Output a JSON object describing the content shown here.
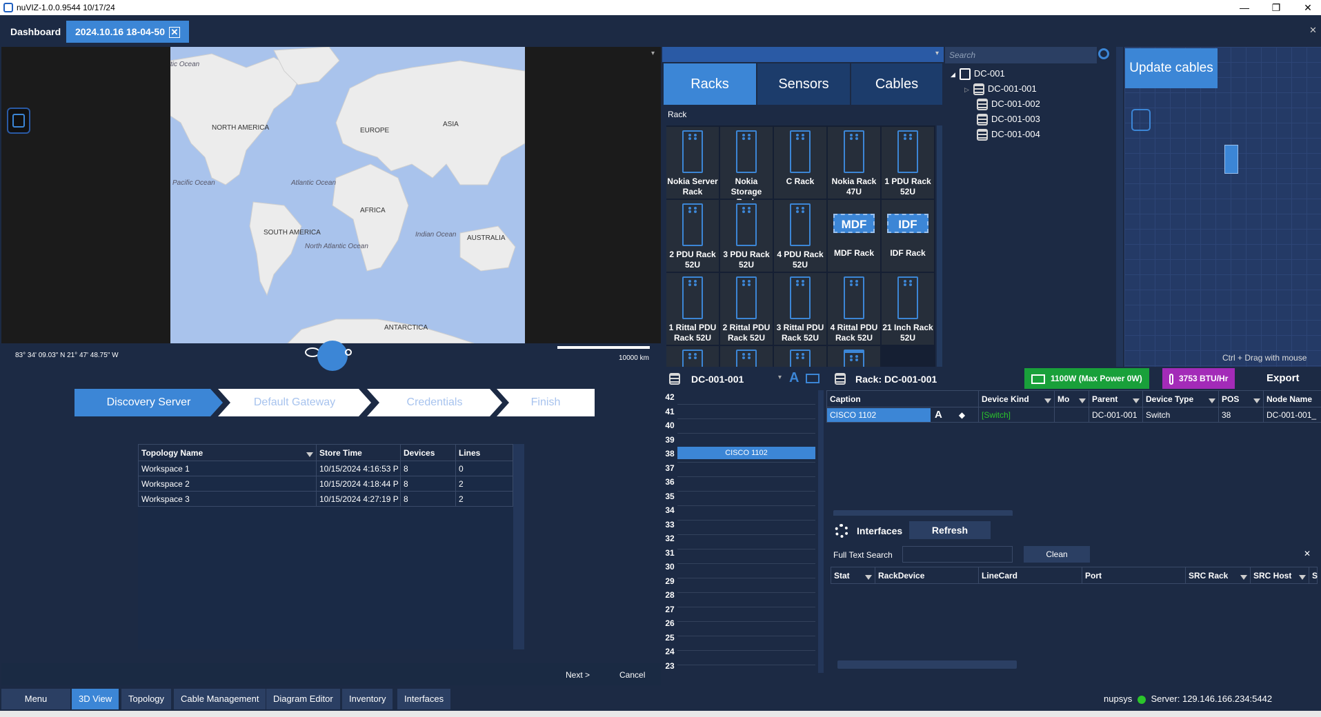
{
  "window": {
    "title": "nuVIZ-1.0.0.9544 10/17/24",
    "minimize": "—",
    "maximize": "❐",
    "close": "✕"
  },
  "tabs": [
    {
      "label": "Dashboard"
    },
    {
      "label": "2024.10.16 18-04-50"
    }
  ],
  "tab_close": "✕",
  "map": {
    "labels": {
      "arctic": "tic Ocean",
      "north_america": "NORTH AMERICA",
      "europe": "EUROPE",
      "asia": "ASIA",
      "pacific": "Pacific Ocean",
      "atlantic": "Atlantic Ocean",
      "africa": "AFRICA",
      "south_america": "SOUTH AMERICA",
      "north_atlantic": "North Atlantic Ocean",
      "indian": "Indian Ocean",
      "australia": "AUSTRALIA",
      "antarctica": "ANTARCTICA"
    },
    "coordinates": "83° 34' 09.03\" N 21° 47' 48.75\" W",
    "scale_label": "10000 km"
  },
  "wizard": {
    "steps": [
      "Discovery Server",
      "Default Gateway",
      "Credentials",
      "Finish"
    ]
  },
  "topology_table": {
    "headers": [
      "Topology Name",
      "Store Time",
      "Devices",
      "Lines"
    ],
    "rows": [
      [
        "Workspace 1",
        "10/15/2024 4:16:53 P",
        "8",
        "0"
      ],
      [
        "Workspace 2",
        "10/15/2024 4:18:44 P",
        "8",
        "2"
      ],
      [
        "Workspace 3",
        "10/15/2024 4:27:19 P",
        "8",
        "2"
      ]
    ]
  },
  "footer": {
    "next": "Next >",
    "cancel": "Cancel"
  },
  "menubar": {
    "items": [
      "Menu",
      "3D View",
      "Topology",
      "Cable Management",
      "Diagram Editor",
      "Inventory",
      "Interfaces"
    ],
    "active_index": 1
  },
  "catalog": {
    "tabs": [
      "Racks",
      "Sensors",
      "Cables"
    ],
    "section": "Rack",
    "items": [
      "Nokia Server Rack",
      "Nokia Storage Rack",
      "C Rack",
      "Nokia Rack 47U",
      "1 PDU Rack 52U",
      "2 PDU Rack 52U",
      "3 PDU Rack 52U",
      "4 PDU Rack 52U",
      "MDF Rack",
      "IDF Rack",
      "1 Rittal PDU Rack 52U",
      "2 Rittal PDU Rack 52U",
      "3 Rittal PDU Rack 52U",
      "4 Rittal PDU Rack 52U",
      "21 Inch Rack 52U"
    ],
    "tags": {
      "mdf": "MDF",
      "idf": "IDF"
    }
  },
  "tree": {
    "search_placeholder": "Search",
    "root": "DC-001",
    "children": [
      "DC-001-001",
      "DC-001-002",
      "DC-001-003",
      "DC-001-004"
    ]
  },
  "view3d": {
    "update_button": "Update cables",
    "hint": "Ctrl + Drag with mouse"
  },
  "rack_panel": {
    "selector_value": "DC-001-001",
    "font_icon": "A",
    "units": [
      "42",
      "41",
      "40",
      "39",
      "38",
      "37",
      "36",
      "35",
      "34",
      "33",
      "32",
      "31",
      "30",
      "29",
      "28",
      "27",
      "26",
      "25",
      "24",
      "23"
    ],
    "device": "CISCO 1102"
  },
  "rack_detail": {
    "title": "Rack: DC-001-001",
    "power": "1100W (Max Power 0W)",
    "heat": "3753 BTU/Hr",
    "export": "Export",
    "headers": [
      "Caption",
      "Device Kind",
      "Mo",
      "Parent",
      "Device Type",
      "POS",
      "Node Name"
    ],
    "row": [
      "CISCO 1102",
      "[Switch]",
      "",
      "DC-001-001",
      "Switch",
      "38",
      "DC-001-001_"
    ]
  },
  "interfaces": {
    "title": "Interfaces",
    "refresh": "Refresh",
    "search_label": "Full Text Search",
    "clean": "Clean",
    "close": "✕",
    "headers": [
      "Stat",
      "RackDevice",
      "LineCard",
      "Port",
      "SRC Rack",
      "SRC Host",
      "S"
    ]
  },
  "status": {
    "user": "nupsys",
    "server": "Server: 129.146.166.234:5442",
    "online_color": "#2bc52b"
  },
  "colors": {
    "accent": "#3c86d6",
    "background": "#1c2a44",
    "power_badge": "#19a03a",
    "heat_badge": "#a32bb8"
  }
}
